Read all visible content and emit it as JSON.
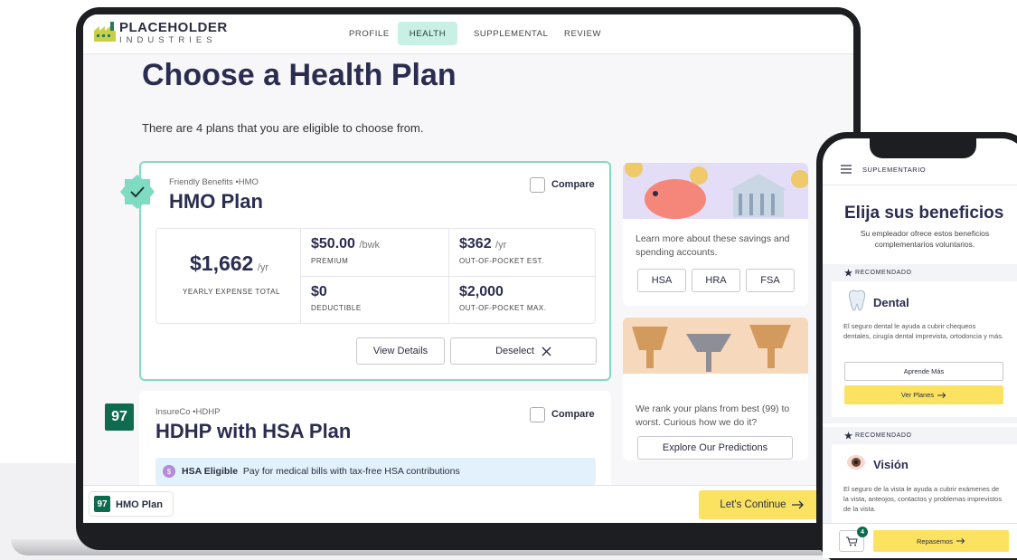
{
  "laptop": {
    "logo": {
      "line1": "PLACEHOLDER",
      "line2": "INDUSTRIES"
    },
    "nav": [
      "PROFILE",
      "HEALTH",
      "SUPPLEMENTAL",
      "REVIEW"
    ],
    "nav_active": "HEALTH",
    "page_title": "Choose a Health Plan",
    "page_subtitle": "There are 4 plans that you are eligible to choose from.",
    "plan1": {
      "provider": "Friendly Benefits •HMO",
      "name": "HMO Plan",
      "compare_label": "Compare",
      "yearly_total": "$1,662",
      "yearly_unit": "/yr",
      "yearly_label": "YEARLY EXPENSE TOTAL",
      "premium": "$50.00",
      "premium_unit": "/bwk",
      "premium_label": "PREMIUM",
      "oop_est": "$362",
      "oop_est_unit": "/yr",
      "oop_est_label": "OUT-OF-POCKET EST.",
      "deductible": "$0",
      "deductible_label": "DEDUCTIBLE",
      "oop_max": "$2,000",
      "oop_max_label": "OUT-OF-POCKET MAX.",
      "view_details": "View Details",
      "deselect": "Deselect",
      "selected": true
    },
    "plan2": {
      "score": "97",
      "provider": "InsureCo •HDHP",
      "name": "HDHP with HSA Plan",
      "compare_label": "Compare",
      "hsa_badge": "$",
      "hsa_title": "HSA Eligible",
      "hsa_text": "Pay for medical bills with tax-free HSA contributions"
    },
    "side_savings": {
      "text": "Learn more about these savings and spending accounts.",
      "buttons": [
        "HSA",
        "HRA",
        "FSA"
      ]
    },
    "side_rank": {
      "text": "We rank your plans from best (99) to worst. Curious how we do it?",
      "button": "Explore Our Predictions"
    },
    "bottom_bar": {
      "score": "97",
      "plan": "HMO Plan",
      "continue": "Let's Continue"
    }
  },
  "phone": {
    "nav_label": "SUPLEMENTARIO",
    "title": "Elija sus beneficios",
    "subtitle": "Su empleador ofrece estos beneficios complementarios voluntarios.",
    "section1": {
      "recommended": "RECOMENDADO",
      "name": "Dental",
      "body": "El seguro dental le ayuda a cubrir chequeos dentales, cirugía dental imprevista, ortodoncia y más.",
      "learn": "Aprende Más",
      "view": "Ver Planes"
    },
    "section2": {
      "recommended": "RECOMENDADO",
      "name": "Visión",
      "body": "El seguro de la vista le ayuda a cubrir exámenes de la vista, anteojos, contactos y problemas imprevistos de la vista."
    },
    "cart_count": "4",
    "continue": "Repasemos"
  },
  "colors": {
    "accent_green": "#7fdcc3",
    "score_green": "#0e6b4e",
    "cta_yellow": "#fbe361",
    "title_navy": "#2b2d50"
  }
}
